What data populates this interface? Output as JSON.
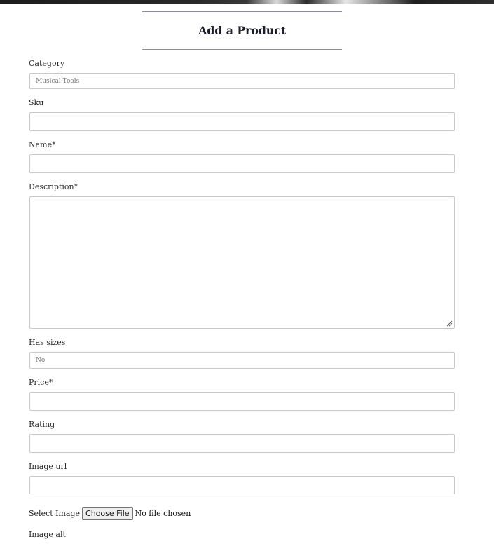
{
  "page": {
    "title": "Add a Product"
  },
  "form": {
    "category": {
      "label": "Category",
      "value": "Musical Tools"
    },
    "sku": {
      "label": "Sku",
      "value": ""
    },
    "name": {
      "label": "Name*",
      "value": ""
    },
    "description": {
      "label": "Description*",
      "value": ""
    },
    "has_sizes": {
      "label": "Has sizes",
      "value": "No"
    },
    "price": {
      "label": "Price*",
      "value": ""
    },
    "rating": {
      "label": "Rating",
      "value": ""
    },
    "image_url": {
      "label": "Image url",
      "value": ""
    },
    "select_image": {
      "label": "Select Image",
      "button_label": "Choose File",
      "status": "No file chosen"
    },
    "image_alt": {
      "label": "Image alt"
    }
  },
  "icons": {
    "resize": "resize-grip-icon"
  }
}
